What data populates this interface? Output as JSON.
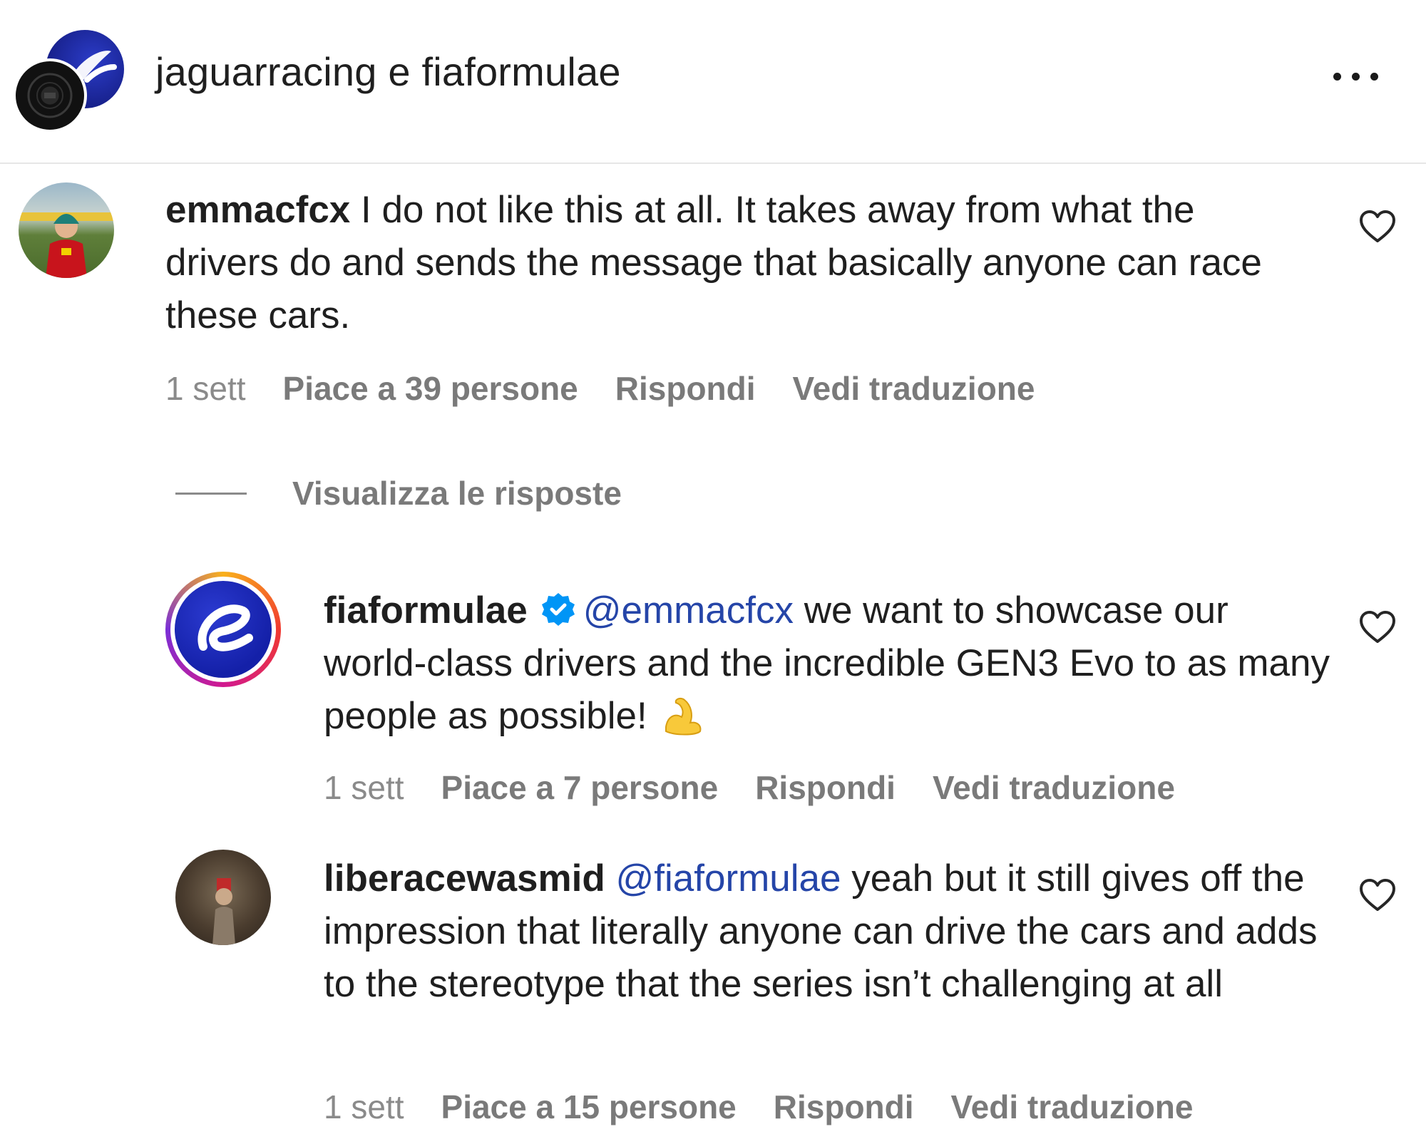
{
  "header": {
    "title": "jaguarracing e fiaformulae",
    "more_icon": "more-horizontal-icon"
  },
  "comments": [
    {
      "username": "emmacfcx",
      "text": " I do not like this at all. It takes away from what the drivers do and sends the message that basically anyone can race these cars.",
      "time": "1 sett",
      "likes": "Piace a 39 persone",
      "reply": "Rispondi",
      "translate": "Vedi traduzione"
    }
  ],
  "view_replies": "Visualizza le risposte",
  "replies": [
    {
      "username": "fiaformulae",
      "verified": true,
      "mention": "@emmacfcx",
      "text": " we want to showcase our world-class drivers and the incredible GEN3 Evo to as many people as possible!",
      "emoji": "flexed-biceps-emoji",
      "time": "1 sett",
      "likes": "Piace a 7 persone",
      "reply": "Rispondi",
      "translate": "Vedi traduzione"
    },
    {
      "username": "liberacewasmid",
      "mention": "@fiaformulae",
      "text": " yeah but it still gives off the impression that literally anyone can drive the cars and adds to the stereotype that the series isn’t challenging at all",
      "time": "1 sett",
      "likes": "Piace a 15 persone",
      "reply": "Rispondi",
      "translate": "Vedi traduzione"
    }
  ],
  "colors": {
    "mention": "#2545a8",
    "meta": "#7a7a7a",
    "verified": "#0095f6",
    "divider": "#e6e6e6"
  }
}
